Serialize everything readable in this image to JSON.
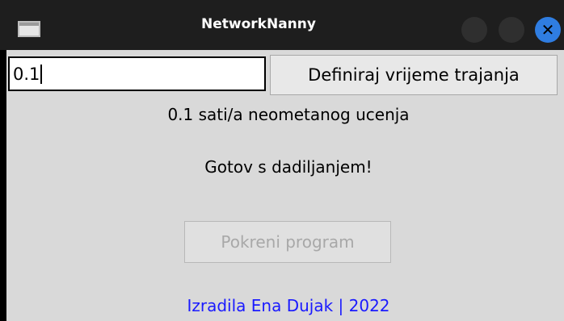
{
  "window": {
    "title": "NetworkNanny",
    "close_glyph": "✕"
  },
  "duration": {
    "input_value": "0.1",
    "define_button_label": "Definiraj vrijeme trajanja"
  },
  "status": {
    "hours_text": "0.1 sati/a neometanog ucenja",
    "done_text": "Gotov s dadiljanjem!"
  },
  "actions": {
    "start_button_label": "Pokreni program",
    "start_button_enabled": false
  },
  "footer": {
    "credit_text": "Izradila Ena Dujak | 2022"
  },
  "colors": {
    "titlebar": "#1e1e1e",
    "content_bg": "#d9d9d9",
    "close_button": "#2f7de1",
    "credit_text": "#1a1aff"
  }
}
